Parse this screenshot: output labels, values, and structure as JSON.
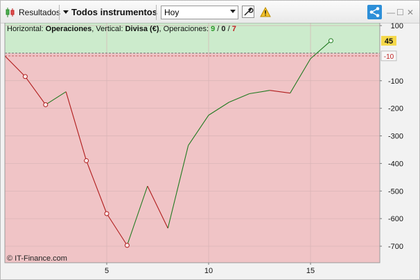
{
  "toolbar": {
    "results_label": "Resultados",
    "instruments_label": "Todos instrumentos",
    "period_value": "Hoy",
    "window_controls": [
      "—",
      "☐",
      "✕"
    ]
  },
  "chart_data": {
    "type": "line",
    "header": {
      "prefix": "Horizontal: ",
      "h_value": "Operaciones",
      "mid": ", Vertical: ",
      "v_value": "Divisa (€)",
      "ops_label": ", Operaciones: ",
      "ops_total": "9",
      "ops_zero": "0",
      "ops_losing": "7",
      "sep": " / "
    },
    "x": [
      0,
      1,
      2,
      3,
      4,
      5,
      6,
      7,
      8,
      9,
      10,
      11,
      12,
      13,
      14,
      15,
      16
    ],
    "values": [
      -10,
      -85,
      -187,
      -140,
      -390,
      -582,
      -697,
      -482,
      -635,
      -335,
      -225,
      -178,
      -147,
      -135,
      -145,
      -20,
      45
    ],
    "losing_marker_indices": [
      1,
      2,
      4,
      5,
      6
    ],
    "final_marker_index": 16,
    "xlim": [
      0,
      18.4
    ],
    "ylim": [
      -760,
      110
    ],
    "xticks": [
      5,
      10,
      15
    ],
    "yticks": [
      100,
      -100,
      -200,
      -300,
      -400,
      -500,
      -600,
      -700
    ],
    "ytick_labels": [
      "100",
      "-100",
      "-200",
      "-300",
      "-400",
      "-500",
      "-600",
      "-700"
    ],
    "last_value_label": "45",
    "baseline_value": -10,
    "baseline_label": "-10",
    "credit": "© IT-Finance.com",
    "colors": {
      "profit_zone": "#ccebcc",
      "loss_zone": "#f0c4c6",
      "up_line": "#1f7a1f",
      "down_line": "#b01c1c",
      "last_value_bg": "#f5d84a",
      "ops_total": "#2c9a2c",
      "ops_zero": "#222222",
      "ops_losing": "#c02020"
    }
  }
}
